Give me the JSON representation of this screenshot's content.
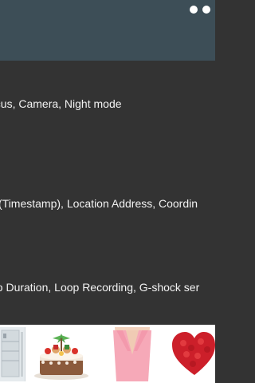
{
  "header": {
    "status_bar_color": "#3d4e57",
    "app_bar_color": "#3d4e57"
  },
  "features": {
    "line1": "ocus, Camera, Night mode",
    "line2": "(Timestamp), Location Address, Coordin",
    "line3": "eo Duration, Loop Recording, G-shock ser"
  },
  "thumbnails": [
    {
      "name": "appliance-thumbnail"
    },
    {
      "name": "cake-thumbnail"
    },
    {
      "name": "pink-top-thumbnail"
    },
    {
      "name": "heart-roses-thumbnail"
    }
  ]
}
